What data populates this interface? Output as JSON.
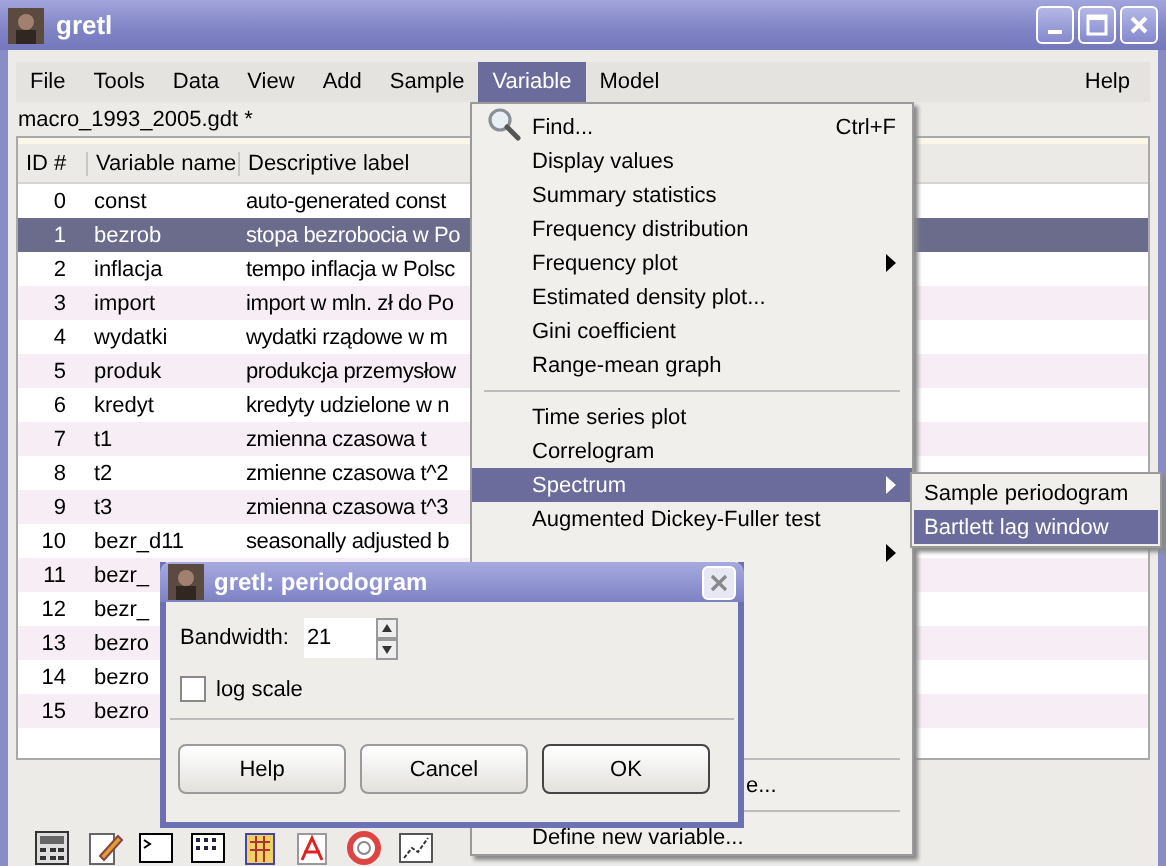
{
  "window": {
    "title": "gretl"
  },
  "menubar": [
    {
      "label": "File",
      "selected": false
    },
    {
      "label": "Tools",
      "selected": false
    },
    {
      "label": "Data",
      "selected": false
    },
    {
      "label": "View",
      "selected": false
    },
    {
      "label": "Add",
      "selected": false
    },
    {
      "label": "Sample",
      "selected": false
    },
    {
      "label": "Variable",
      "selected": true
    },
    {
      "label": "Model",
      "selected": false
    },
    {
      "label": "Help",
      "selected": false
    }
  ],
  "filename": "macro_1993_2005.gdt *",
  "table": {
    "columns": [
      "ID #",
      "Variable name",
      "Descriptive label"
    ],
    "rows": [
      {
        "id": "0",
        "name": "const",
        "label": "auto-generated const",
        "selected": false
      },
      {
        "id": "1",
        "name": "bezrob",
        "label": "stopa bezrobocia w Po",
        "selected": true
      },
      {
        "id": "2",
        "name": "inflacja",
        "label": "tempo inflacja w Polsc",
        "selected": false
      },
      {
        "id": "3",
        "name": "import",
        "label": "import w mln. zł do Po",
        "selected": false
      },
      {
        "id": "4",
        "name": "wydatki",
        "label": "wydatki rządowe w m",
        "selected": false
      },
      {
        "id": "5",
        "name": "produk",
        "label": "produkcja przemysłow",
        "selected": false
      },
      {
        "id": "6",
        "name": "kredyt",
        "label": "kredyty udzielone w n",
        "selected": false
      },
      {
        "id": "7",
        "name": "t1",
        "label": "zmienna czasowa t",
        "selected": false
      },
      {
        "id": "8",
        "name": "t2",
        "label": "zmienne czasowa t^2",
        "selected": false
      },
      {
        "id": "9",
        "name": "t3",
        "label": "zmienna czasowa t^3",
        "selected": false
      },
      {
        "id": "10",
        "name": "bezr_d11",
        "label": "seasonally adjusted b",
        "selected": false
      },
      {
        "id": "11",
        "name": "bezr_",
        "selected": false
      },
      {
        "id": "12",
        "name": "bezr_",
        "selected": false
      },
      {
        "id": "13",
        "name": "bezro",
        "selected": false
      },
      {
        "id": "14",
        "name": "bezro",
        "selected": false
      },
      {
        "id": "15",
        "name": "bezro",
        "selected": false
      }
    ]
  },
  "variable_menu": {
    "items": [
      {
        "kind": "item",
        "label": "Find...",
        "shortcut": "Ctrl+F",
        "selected": false
      },
      {
        "kind": "item",
        "label": "Display values",
        "selected": false
      },
      {
        "kind": "item",
        "label": "Summary statistics",
        "selected": false
      },
      {
        "kind": "item",
        "label": "Frequency distribution",
        "selected": false
      },
      {
        "kind": "item",
        "label": "Frequency plot",
        "submenu": true,
        "selected": false
      },
      {
        "kind": "item",
        "label": "Estimated density plot...",
        "selected": false
      },
      {
        "kind": "item",
        "label": "Gini coefficient",
        "selected": false
      },
      {
        "kind": "item",
        "label": "Range-mean graph",
        "selected": false
      },
      {
        "kind": "separator"
      },
      {
        "kind": "item",
        "label": "Time series plot",
        "selected": false
      },
      {
        "kind": "item",
        "label": "Correlogram",
        "selected": false
      },
      {
        "kind": "item",
        "label": "Spectrum",
        "submenu": true,
        "selected": true
      },
      {
        "kind": "item",
        "label": "Augmented Dickey-Fuller test",
        "selected": false
      },
      {
        "kind": "item",
        "submenu": true,
        "selected": false
      }
    ],
    "bottom_items": [
      {
        "kind": "separator"
      },
      {
        "kind": "fragment",
        "label": "e...",
        "selected": false
      },
      {
        "kind": "separator"
      },
      {
        "kind": "item",
        "label": "Define new variable...",
        "selected": false
      }
    ]
  },
  "spectrum_submenu": [
    {
      "label": "Sample periodogram",
      "selected": false
    },
    {
      "label": "Bartlett lag window",
      "selected": true
    }
  ],
  "dialog": {
    "title": "gretl: periodogram",
    "bandwidth_label": "Bandwidth:",
    "bandwidth": "21",
    "log_scale": {
      "label": "log scale",
      "checked": false
    },
    "buttons": [
      {
        "label": "Help",
        "default": false
      },
      {
        "label": "Cancel",
        "default": false
      },
      {
        "label": "OK",
        "default": true
      }
    ]
  }
}
